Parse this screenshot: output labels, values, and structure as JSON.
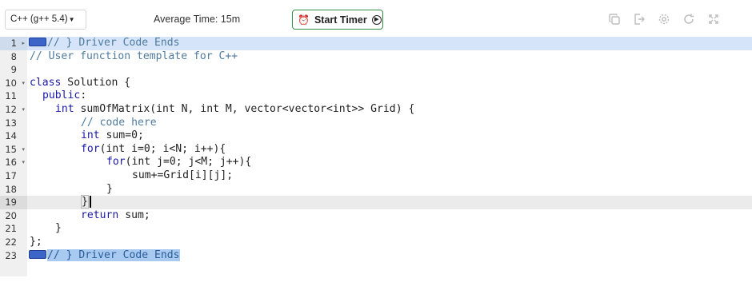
{
  "toolbar": {
    "language": "C++ (g++ 5.4)",
    "average_time": "Average Time: 15m",
    "start_timer_label": "Start Timer",
    "icons": [
      "copy-icon",
      "export-icon",
      "settings-icon",
      "reset-icon",
      "fullscreen-icon"
    ]
  },
  "editor": {
    "lines": [
      {
        "num": "1",
        "fold": "▸",
        "text": "// } Driver Code Ends"
      },
      {
        "num": "8",
        "fold": "",
        "text": "// User function template for C++"
      },
      {
        "num": "9",
        "fold": "",
        "text": ""
      },
      {
        "num": "10",
        "fold": "▾",
        "kw": "class",
        "text": " Solution {"
      },
      {
        "num": "11",
        "fold": "",
        "kw": "public",
        "text": ":"
      },
      {
        "num": "12",
        "fold": "▾",
        "kw": "int",
        "text": " sumOfMatrix(int N, int M, vector<vector<int>> Grid) {"
      },
      {
        "num": "13",
        "fold": "",
        "text": "// code here"
      },
      {
        "num": "14",
        "fold": "",
        "kw": "int",
        "text": " sum=0;"
      },
      {
        "num": "15",
        "fold": "▾",
        "kw": "for",
        "text": "(int i=0; i<N; i++){"
      },
      {
        "num": "16",
        "fold": "▾",
        "kw": "for",
        "text": "(int j=0; j<M; j++){"
      },
      {
        "num": "17",
        "fold": "",
        "text": "sum+=Grid[i][j];"
      },
      {
        "num": "18",
        "fold": "",
        "text": "}"
      },
      {
        "num": "19",
        "fold": "",
        "text": "}"
      },
      {
        "num": "20",
        "fold": "",
        "kw": "return",
        "text": " sum;"
      },
      {
        "num": "21",
        "fold": "",
        "text": "}"
      },
      {
        "num": "22",
        "fold": "",
        "text": "};"
      },
      {
        "num": "23",
        "fold": "",
        "text": "// } Driver Code Ends"
      }
    ]
  }
}
